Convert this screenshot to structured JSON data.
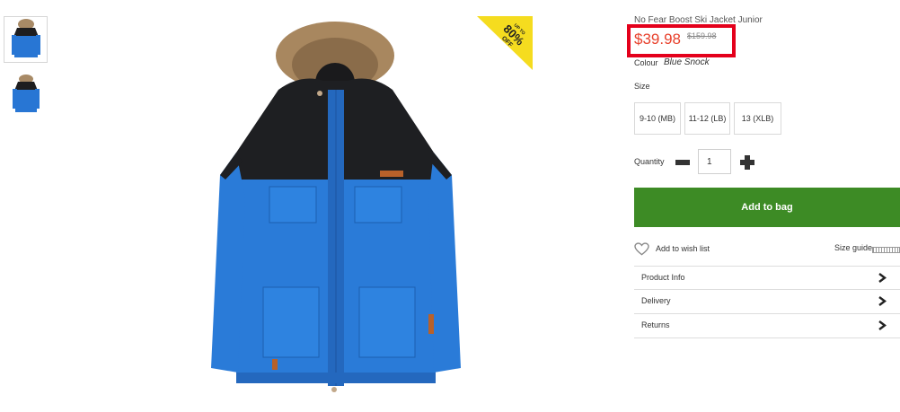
{
  "gallery": {
    "thumbnails": [
      {
        "alt": "jacket-front-thumbnail",
        "selected": true
      },
      {
        "alt": "jacket-alt-thumbnail",
        "selected": false
      }
    ],
    "badge": {
      "line1": "UP TO",
      "line2": "80%",
      "line3": "OFF",
      "color": "#f5dc1f"
    }
  },
  "product": {
    "title": "No Fear Boost Ski Jacket Junior",
    "price_now": "$39.98",
    "price_was": "$159.98",
    "price_color": "#e8412c",
    "highlight_color": "#e4001b",
    "colour_label": "Colour",
    "colour_value": "Blue Snock"
  },
  "size": {
    "label": "Size",
    "options": [
      "9-10 (MB)",
      "11-12 (LB)",
      "13 (XLB)"
    ]
  },
  "quantity": {
    "label": "Quantity",
    "value": "1"
  },
  "actions": {
    "add_to_bag": "Add to bag",
    "add_to_bag_color": "#3d8b25",
    "wishlist": "Add to wish list",
    "size_guide": "Size guide"
  },
  "accordion": [
    {
      "label": "Product Info",
      "icon": "chevron-right-icon"
    },
    {
      "label": "Delivery",
      "icon": "chevron-right-icon"
    },
    {
      "label": "Returns",
      "icon": "chevron-right-icon"
    }
  ]
}
